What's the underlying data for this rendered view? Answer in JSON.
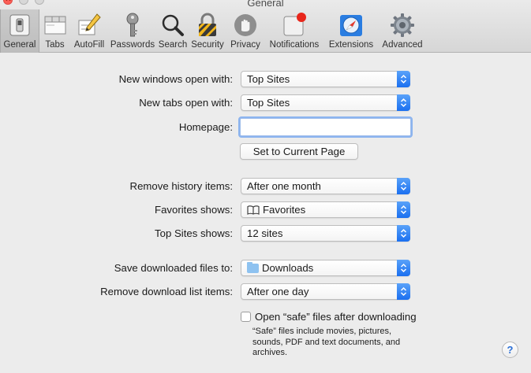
{
  "window": {
    "title": "General"
  },
  "toolbar": {
    "tabs": [
      {
        "label": "General",
        "icon": "general-switch-icon"
      },
      {
        "label": "Tabs",
        "icon": "tabs-icon"
      },
      {
        "label": "AutoFill",
        "icon": "pencil-form-icon"
      },
      {
        "label": "Passwords",
        "icon": "key-icon"
      },
      {
        "label": "Search",
        "icon": "magnifier-icon"
      },
      {
        "label": "Security",
        "icon": "padlock-icon"
      },
      {
        "label": "Privacy",
        "icon": "hand-icon"
      },
      {
        "label": "Notifications",
        "icon": "notifications-icon"
      },
      {
        "label": "Extensions",
        "icon": "compass-icon"
      },
      {
        "label": "Advanced",
        "icon": "gear-icon"
      }
    ],
    "selected": "General"
  },
  "form": {
    "new_windows": {
      "label": "New windows open with:",
      "value": "Top Sites"
    },
    "new_tabs": {
      "label": "New tabs open with:",
      "value": "Top Sites"
    },
    "homepage": {
      "label": "Homepage:",
      "value": "",
      "placeholder": ""
    },
    "set_current_page": {
      "label": "Set to Current Page"
    },
    "remove_history": {
      "label": "Remove history items:",
      "value": "After one month"
    },
    "favorites_shows": {
      "label": "Favorites shows:",
      "value": "Favorites",
      "icon": "book-icon"
    },
    "top_sites_shows": {
      "label": "Top Sites shows:",
      "value": "12 sites"
    },
    "save_downloads": {
      "label": "Save downloaded files to:",
      "value": "Downloads",
      "icon": "folder-icon"
    },
    "remove_downloads": {
      "label": "Remove download list items:",
      "value": "After one day"
    },
    "open_safe": {
      "label": "Open “safe” files after downloading",
      "checked": false,
      "note_lines": [
        "“Safe” files include movies, pictures,",
        "sounds, PDF and text documents, and",
        "archives."
      ]
    },
    "help": {
      "label": "?"
    }
  },
  "colors": {
    "accent": "#1a6ff0",
    "background": "#ececec",
    "close": "#fc5f57"
  }
}
